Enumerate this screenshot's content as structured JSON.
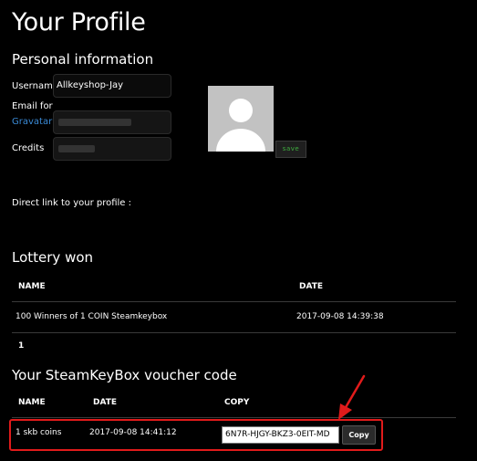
{
  "page": {
    "title": "Your Profile"
  },
  "personal": {
    "heading": "Personal information",
    "username_label": "Username",
    "username_value": "Allkeyshop-Jay",
    "email_label_line1": "Email for",
    "email_label_link": "Gravatar",
    "credits_label": "Credits",
    "save_label": "save",
    "direct_link_label": "Direct link to your profile :"
  },
  "lottery": {
    "heading": "Lottery won",
    "col_name": "NAME",
    "col_date": "DATE",
    "rows": [
      {
        "name": "100 Winners of 1 COIN Steamkeybox",
        "date": "2017-09-08 14:39:38"
      }
    ],
    "pagination": "1"
  },
  "voucher": {
    "heading": "Your SteamKeyBox voucher code",
    "col_name": "NAME",
    "col_date": "DATE",
    "col_copy": "COPY",
    "rows": [
      {
        "name": "1 skb coins",
        "date": "2017-09-08 14:41:12",
        "code": "6N7R-HJGY-BKZ3-0EIT-MD",
        "copy_label": "Copy"
      }
    ]
  },
  "colors": {
    "background": "#000000",
    "link": "#3a8ad6",
    "save_text": "#3fae3f",
    "annotation": "#e11b1b"
  },
  "icons": [
    "user-avatar-icon",
    "annotation-arrow-icon"
  ]
}
